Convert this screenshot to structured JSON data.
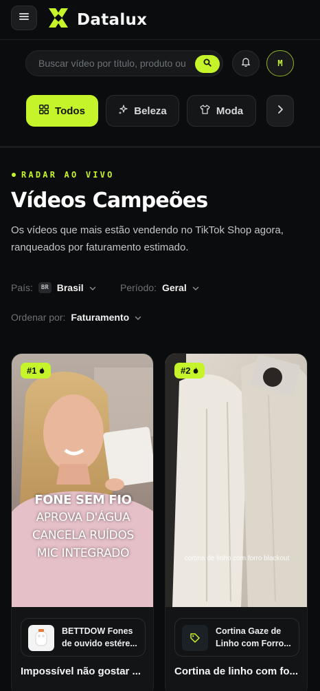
{
  "app": {
    "brand": "Datalux",
    "avatar_initial": "M"
  },
  "search": {
    "placeholder": "Buscar vídeo por título, produto ou",
    "value": ""
  },
  "categories": [
    {
      "label": "Todos",
      "icon": "grid-icon",
      "active": true
    },
    {
      "label": "Beleza",
      "icon": "sparkle-icon",
      "active": false
    },
    {
      "label": "Moda",
      "icon": "shirt-icon",
      "active": false
    }
  ],
  "hero": {
    "eyebrow": "RADAR AO VIVO",
    "title": "Vídeos Campeões",
    "subtitle": "Os vídeos que mais estão vendendo no TikTok Shop agora, ranqueados por faturamento estimado."
  },
  "filters": {
    "country": {
      "label": "País:",
      "badge": "BR",
      "value": "Brasil"
    },
    "period": {
      "label": "Período:",
      "value": "Geral"
    },
    "sort": {
      "label": "Ordenar por:",
      "value": "Faturamento"
    }
  },
  "videos": [
    {
      "rank": "#1",
      "overlay": [
        "FONE SEM FIO",
        "APROVA D'ÁGUA",
        "CANCELA RUÍDOS",
        "MIC INTEGRADO"
      ],
      "product_name": "BETTDOW Fones de ouvido estére...",
      "title": "Impossível não gostar ..."
    },
    {
      "rank": "#2",
      "caption": "cortina de linho com forro blackout",
      "product_name": "Cortina Gaze de Linho com Forro...",
      "title": "Cortina de linho com fo..."
    }
  ],
  "colors": {
    "accent": "#c6f42a",
    "background": "#0b0c0d"
  }
}
